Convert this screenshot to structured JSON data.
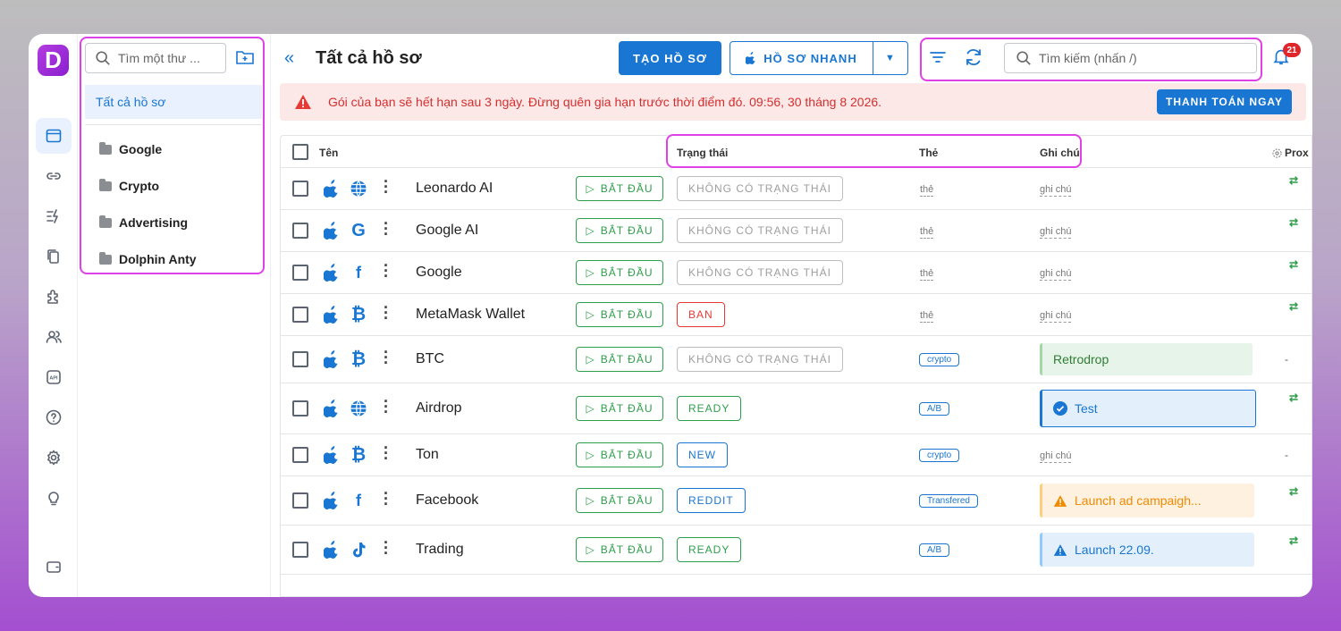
{
  "app": {
    "logo_letter": "D"
  },
  "folders": {
    "search_placeholder": "Tìm một thư ...",
    "all_label": "Tất cả hồ sơ",
    "items": [
      {
        "label": "Google"
      },
      {
        "label": "Crypto"
      },
      {
        "label": "Advertising"
      },
      {
        "label": "Dolphin Anty"
      }
    ]
  },
  "header": {
    "back_icon": "«",
    "title": "Tất cả hồ sơ",
    "create_label": "TẠO HỒ SƠ",
    "quick_label": "HỒ SƠ NHANH",
    "quick_dropdown": "▼",
    "search_placeholder": "Tìm kiếm (nhấn /)",
    "notifications_count": "21"
  },
  "alert": {
    "text": "Gói của bạn sẽ hết hạn sau 3 ngày. Đừng quên gia hạn trước thời điểm đó. 09:56, 30 tháng 8 2026.",
    "button_label": "THANH TOÁN NGAY"
  },
  "table": {
    "columns": {
      "name": "Tên",
      "status": "Trạng thái",
      "tags": "Thẻ",
      "notes": "Ghi chú",
      "proxy": "Prox"
    },
    "start_label": "BẮT ĐẦU",
    "rows": [
      {
        "name": "Leonardo AI",
        "site_icon": "globe-icon",
        "status": "KHÔNG CÓ TRẠNG THÁI",
        "status_color": "#9e9e9e",
        "tag": "thẻ",
        "note": "ghi chú",
        "proxy": "⇄"
      },
      {
        "name": "Google AI",
        "site_icon": "google-icon",
        "status": "KHÔNG CÓ TRẠNG THÁI",
        "status_color": "#9e9e9e",
        "tag": "thẻ",
        "note": "ghi chú",
        "proxy": "⇄"
      },
      {
        "name": "Google",
        "site_icon": "facebook-icon",
        "status": "KHÔNG CÓ TRẠNG THÁI",
        "status_color": "#9e9e9e",
        "tag": "thẻ",
        "note": "ghi chú",
        "proxy": "⇄"
      },
      {
        "name": "MetaMask Wallet",
        "site_icon": "bitcoin-icon",
        "status": "BAN",
        "status_color": "#e53935",
        "tag": "thẻ",
        "note": "ghi chú",
        "proxy": "⇄"
      },
      {
        "name": "BTC",
        "site_icon": "bitcoin-icon",
        "status": "KHÔNG CÓ TRẠNG THÁI",
        "status_color": "#9e9e9e",
        "tag": "crypto",
        "note": "Retrodrop",
        "proxy": "-"
      },
      {
        "name": "Airdrop",
        "site_icon": "globe-icon",
        "status": "READY",
        "status_color": "#2e9e4a",
        "tag": "A/B",
        "note": "Test",
        "proxy": "⇄"
      },
      {
        "name": "Ton",
        "site_icon": "bitcoin-icon",
        "status": "NEW",
        "status_color": "#1976d2",
        "tag": "crypto",
        "note": "ghi chú",
        "proxy": "-"
      },
      {
        "name": "Facebook",
        "site_icon": "facebook-icon",
        "status": "REDDIT",
        "status_color": "#1976d2",
        "tag": "Transfered",
        "note": "Launch ad campaigh...",
        "proxy": "⇄"
      },
      {
        "name": "Trading",
        "site_icon": "tiktok-icon",
        "status": "READY",
        "status_color": "#2e9e4a",
        "tag": "A/B",
        "note": "Launch 22.09.",
        "proxy": "⇄"
      }
    ]
  }
}
